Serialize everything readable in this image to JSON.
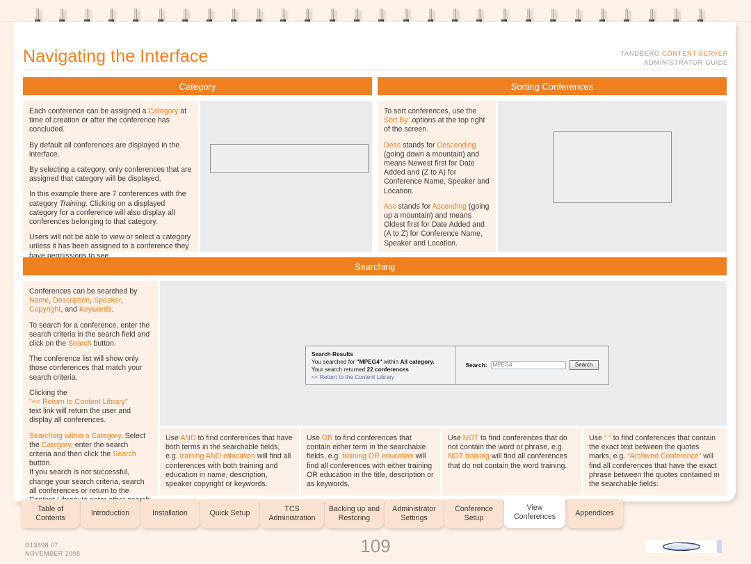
{
  "header": {
    "title": "Navigating the Interface",
    "brand_prefix": "TANDBERG ",
    "brand_product": "CONTENT SERVER",
    "brand_subtitle": "ADMINISTRATOR GUIDE",
    "accent_color": "#f07f20"
  },
  "sections": {
    "category": {
      "bar_label": "Category",
      "paragraphs": [
        "Each conference can be assigned a Category at time of creation or after the conference has concluded.",
        "By default all conferences are displayed in the interface.",
        "By selecting a category, only conferences that are assigned that category will be displayed.",
        "In this example there are 7 conferences with the category Training. Clicking on a displayed category for a conference will also display all conferences belonging to that category.",
        "Users will not be able to view or select a category unless it has been assigned to a conference they have permissions to see."
      ]
    },
    "sorting": {
      "bar_label": "Sorting Conferences",
      "paragraphs": [
        "To sort conferences, use the Sort By: options at the top right of the screen.",
        "Desc stands for Descending (going down a mountain) and means Newest first for Date Added and (Z to A) for Conference Name, Speaker and Location.",
        "Asc stands for Ascending (going up a mountain) and means Oldest first for Date Added and (A to Z) for Conference Name, Speaker and Location."
      ]
    },
    "searching": {
      "bar_label": "Searching",
      "paragraphs": [
        "Conferences can be searched by Name, Description, Speaker, Copyright, and Keywords.",
        "To search for a conference, enter the search criteria in the search field and click on the Search button.",
        "The conference list will show only those conferences that match your search criteria.",
        "Clicking the \"<< Return to Content Library\" text link will return the user and display all conferences.",
        "Searching within a Category. Select the Category, enter the search criteria and then click the Search button. If you search is not successful, change your search criteria, search all conferences or return to the Content Library to enter other search words"
      ]
    }
  },
  "search_mock": {
    "results_heading": "Search Results",
    "searched_for_prefix": "You searched for ",
    "query": "\"MPEG4\"",
    "searched_for_mid": " within ",
    "category_scope": "All category.",
    "returned_prefix": "Your search returned ",
    "returned_count": "22 conferences",
    "return_link": "<< Return to the Content Library",
    "search_label": "Search:",
    "search_value": "MPEG4",
    "search_button": "Search"
  },
  "operators": [
    {
      "name": "and-operator",
      "text": "Use AND to find conferences that have both terms in the searchable fields, e.g. training AND education will find all conferences with both training and education in name, description, speaker copyright or keywords."
    },
    {
      "name": "or-operator",
      "text": "Use OR to find conferences that contain either term in the searchable fields, e.g. training OR education will find all conferences with either training OR education in the title, description or as keywords."
    },
    {
      "name": "not-operator",
      "text": "Use NOT to find conferences that do not contain the word or phrase, e.g. NOT training will find all conferences that do not contain the word training."
    },
    {
      "name": "quotes-operator",
      "text": "Use \" \" to find conferences that contain the exact text between the quotes marks, e.g. \"Archived Conference\" will find all conferences that have the exact phrase between the quotes contained in the searchable fields."
    }
  ],
  "tabs": [
    {
      "label": "Table of Contents",
      "active": false
    },
    {
      "label": "Introduction",
      "active": false
    },
    {
      "label": "Installation",
      "active": false
    },
    {
      "label": "Quick Setup",
      "active": false
    },
    {
      "label": "TCS Administration",
      "active": false
    },
    {
      "label": "Backing up and Restoring",
      "active": false
    },
    {
      "label": "Administrator Settings",
      "active": false
    },
    {
      "label": "Conference Setup",
      "active": false
    },
    {
      "label": "View Conferences",
      "active": true
    },
    {
      "label": "Appendices",
      "active": false
    }
  ],
  "footer": {
    "doc_code": "D13898.07",
    "doc_date": "NOVEMBER 2008",
    "page_number": "109"
  }
}
